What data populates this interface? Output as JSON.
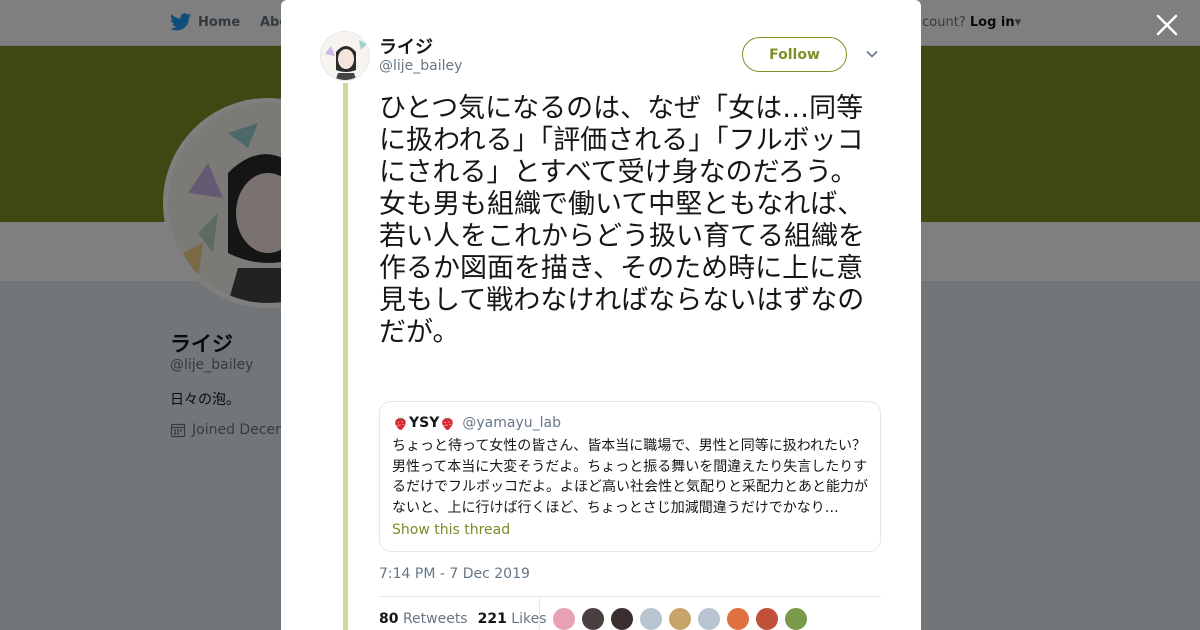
{
  "nav": {
    "home_label": "Home",
    "about_label": "Abo",
    "account_prompt": "ccount?",
    "login_label": "Log in"
  },
  "colors": {
    "brand": "#7c9026",
    "banner": "#7c9026",
    "thread_line": "#d2d79a",
    "link": "#7c8a2a"
  },
  "icons": [
    "twitter-bird-icon",
    "close-icon",
    "chevron-down-icon",
    "calendar-icon",
    "strawberry-icon"
  ],
  "profile": {
    "name": "ライジ",
    "handle": "@lije_bailey",
    "bio": "日々の泡。",
    "joined": "Joined Decem"
  },
  "tweet": {
    "author_name": "ライジ",
    "author_handle": "@lije_bailey",
    "follow_label": "Follow",
    "text": "ひとつ気になるのは、なぜ「女は…同等に扱われる」「評価される」「フルボッコにされる」とすべて受け身なのだろう。\n女も男も組織で働いて中堅ともなれば、若い人をこれからどう扱い育てる組織を作るか図面を描き、そのため時に上に意見もして戦わなければならないはずなのだが。",
    "timestamp": "7:14 PM - 7 Dec 2019",
    "retweets_count": "80",
    "retweets_label": "Retweets",
    "likes_count": "221",
    "likes_label": "Likes"
  },
  "quote": {
    "name": "YSY",
    "handle": "@yamayu_lab",
    "text": "ちょっと待って女性の皆さん、皆本当に職場で、男性と同等に扱われたい？男性って本当に大変そうだよ。ちょっと振る舞いを間違えたり失言したりするだけでフルボッコだよ。よほど高い社会性と気配りと采配力とあと能力がないと、上に行けば行くほど、ちょっとさじ加減間違うだけでかなり…",
    "show_thread": "Show this thread"
  },
  "likers": [
    {
      "color": "#e8a0b4"
    },
    {
      "color": "#4a4040"
    },
    {
      "color": "#3a2e2e"
    },
    {
      "color": "#b8c4d0"
    },
    {
      "color": "#c9a46a"
    },
    {
      "color": "#b8c4d0"
    },
    {
      "color": "#e07040"
    },
    {
      "color": "#c0503a"
    },
    {
      "color": "#7a9a4a"
    }
  ]
}
